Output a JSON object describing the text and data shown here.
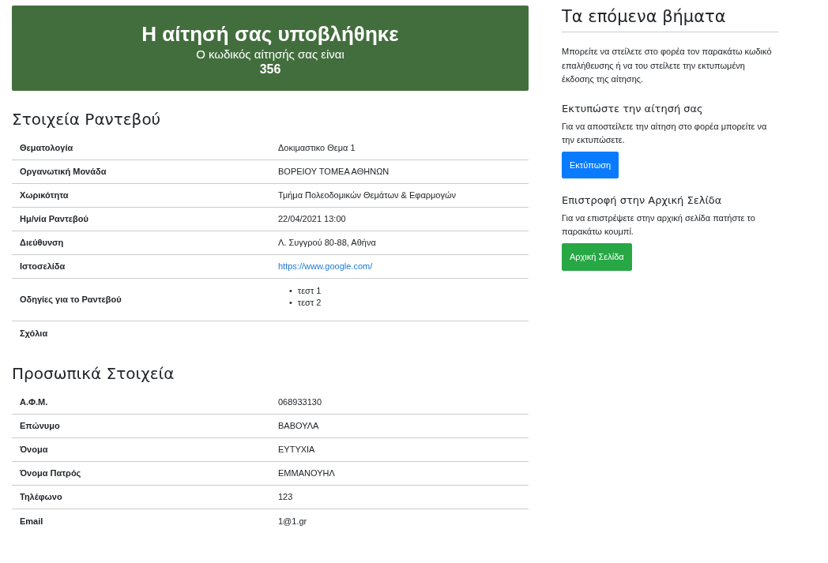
{
  "banner": {
    "title": "Η αίτησή σας υποβλήθηκε",
    "subtitle": "Ο κωδικός αίτησής σας είναι",
    "code": "356"
  },
  "sections": [
    {
      "title": "Στοιχεία Ραντεβού",
      "rows": [
        {
          "kind": "text",
          "label": "Θεματολογία",
          "value": "Δοκιμαστικο Θεμα 1"
        },
        {
          "kind": "text",
          "label": "Οργανωτική Μονάδα",
          "value": "ΒΟΡΕΙΟΥ ΤΟΜΕΑ ΑΘΗΝΩΝ"
        },
        {
          "kind": "text",
          "label": "Χωρικότητα",
          "value": "Τμήμα Πολεοδομικών Θεμάτων & Εφαρμογών"
        },
        {
          "kind": "text",
          "label": "Ημ/νία Ραντεβού",
          "value": "22/04/2021 13:00"
        },
        {
          "kind": "text",
          "label": "Διεύθυνση",
          "value": "Λ. Συγγρού 80-88, Αθήνα"
        },
        {
          "kind": "link",
          "label": "Ιστοσελίδα",
          "value": "https://www.google.com/"
        },
        {
          "kind": "list",
          "label": "Οδηγίες για το Ραντεβού",
          "items": [
            {
              "marker": "•",
              "text": "τεστ 1"
            },
            {
              "marker": "•",
              "text": "τεστ 2"
            }
          ]
        },
        {
          "kind": "empty",
          "label": "Σχόλια"
        }
      ]
    },
    {
      "title": "Προσωπικά Στοιχεία",
      "rows": [
        {
          "kind": "text",
          "label": "Α.Φ.Μ.",
          "value": "068933130"
        },
        {
          "kind": "text",
          "label": "Επώνυμο",
          "value": "ΒΑΒΟΥΛΑ"
        },
        {
          "kind": "text",
          "label": "Όνομα",
          "value": "ΕΥΤΥΧΙΑ"
        },
        {
          "kind": "text",
          "label": "Όνομα Πατρός",
          "value": "ΕΜΜΑΝΟΥΗΛ"
        },
        {
          "kind": "text",
          "label": "Τηλέφωνο",
          "value": "123"
        },
        {
          "kind": "text",
          "label": "Email",
          "value": "1@1.gr"
        }
      ]
    }
  ],
  "next_steps": {
    "title": "Τα επόμενα βήματα",
    "intro": "Μπορείτε να στείλετε στο φορέα τον παρακάτω κωδικό επαλήθευσης ή να του στείλετε την εκτυπωμένη έκδοσης της αίτησης.",
    "blocks": [
      {
        "kind": "print",
        "heading": "Εκτυπώστε την αίτησή σας",
        "text": "Για να αποστείλετε την αίτηση στο φορέα μπορείτε να την εκτυπώσετε.",
        "button": "Εκτύπωση"
      },
      {
        "kind": "home",
        "heading": "Επιστροφή στην Αρχική Σελίδα",
        "text": "Για να επιστρέψετε στην αρχική σελίδα πατήστε το παρακάτω κουμπί.",
        "button": "Αρχική Σελίδα"
      }
    ]
  }
}
